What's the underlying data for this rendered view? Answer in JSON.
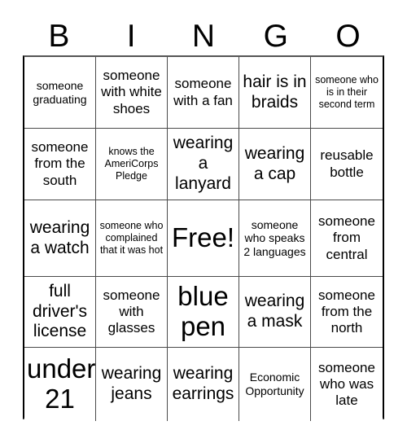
{
  "card": {
    "title": "BINGO",
    "header_letters": [
      "B",
      "I",
      "N",
      "G",
      "O"
    ],
    "grid_size": 5,
    "free_space_index": 12,
    "colors": {
      "text": "#000000",
      "background": "#ffffff",
      "grid_line": "#4a4a4a",
      "grid_border": "#000000"
    }
  },
  "squares": [
    {
      "text": "someone graduating",
      "size": "sm",
      "lines": 2
    },
    {
      "text": "someone with white shoes",
      "size": "md",
      "lines": 3
    },
    {
      "text": "someone with a fan",
      "size": "md",
      "lines": 3
    },
    {
      "text": "hair is in braids",
      "size": "lg",
      "lines": 3
    },
    {
      "text": "someone who is in their second term",
      "size": "xs",
      "lines": 4
    },
    {
      "text": "someone from the south",
      "size": "md",
      "lines": 3
    },
    {
      "text": "knows the AmeriCorps Pledge",
      "size": "xs",
      "lines": 3
    },
    {
      "text": "wearing a lanyard",
      "size": "lg",
      "lines": 3
    },
    {
      "text": "wearing a cap",
      "size": "lg",
      "lines": 2
    },
    {
      "text": "reusable bottle",
      "size": "md",
      "lines": 2
    },
    {
      "text": "wearing a watch",
      "size": "lg",
      "lines": 2
    },
    {
      "text": "someone who complained that it was hot",
      "size": "xs",
      "lines": 5
    },
    {
      "text": "Free!",
      "size": "xxl",
      "lines": 1
    },
    {
      "text": "someone who speaks 2 languages",
      "size": "sm",
      "lines": 4
    },
    {
      "text": "someone from central",
      "size": "md",
      "lines": 3
    },
    {
      "text": "full driver's license",
      "size": "lg",
      "lines": 3
    },
    {
      "text": "someone with glasses",
      "size": "md",
      "lines": 3
    },
    {
      "text": "blue pen",
      "size": "xxl",
      "lines": 2
    },
    {
      "text": "wearing a mask",
      "size": "lg",
      "lines": 2
    },
    {
      "text": "someone from the north",
      "size": "md",
      "lines": 3
    },
    {
      "text": "under 21",
      "size": "xxl",
      "lines": 2
    },
    {
      "text": "wearing jeans",
      "size": "lg",
      "lines": 2
    },
    {
      "text": "wearing earrings",
      "size": "lg",
      "lines": 2
    },
    {
      "text": "Economic Opportunity",
      "size": "sm",
      "lines": 2
    },
    {
      "text": "someone who was late",
      "size": "md",
      "lines": 3
    }
  ]
}
